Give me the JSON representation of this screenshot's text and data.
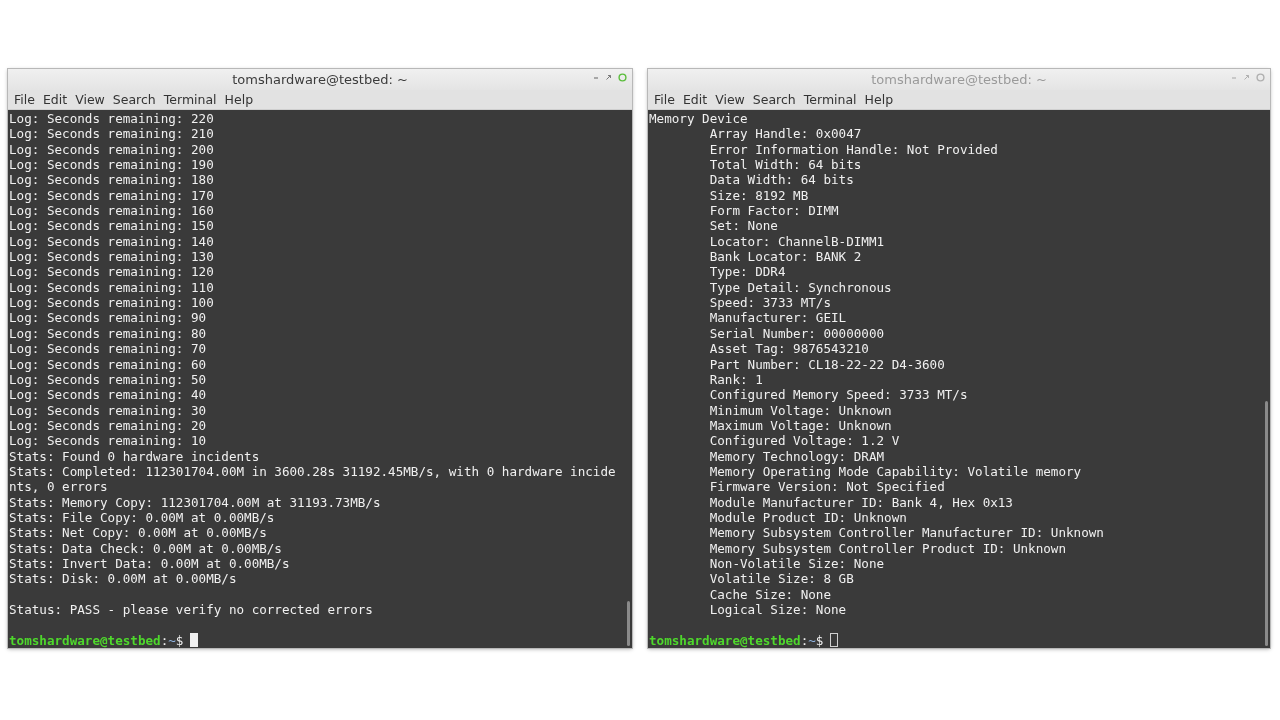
{
  "windows": [
    {
      "title": "tomshardware@testbed: ~",
      "focused": true,
      "menu": [
        "File",
        "Edit",
        "View",
        "Search",
        "Terminal",
        "Help"
      ],
      "lines": [
        {
          "kind": "text",
          "text": "Log: Seconds remaining: 220"
        },
        {
          "kind": "text",
          "text": "Log: Seconds remaining: 210"
        },
        {
          "kind": "text",
          "text": "Log: Seconds remaining: 200"
        },
        {
          "kind": "text",
          "text": "Log: Seconds remaining: 190"
        },
        {
          "kind": "text",
          "text": "Log: Seconds remaining: 180"
        },
        {
          "kind": "text",
          "text": "Log: Seconds remaining: 170"
        },
        {
          "kind": "text",
          "text": "Log: Seconds remaining: 160"
        },
        {
          "kind": "text",
          "text": "Log: Seconds remaining: 150"
        },
        {
          "kind": "text",
          "text": "Log: Seconds remaining: 140"
        },
        {
          "kind": "text",
          "text": "Log: Seconds remaining: 130"
        },
        {
          "kind": "text",
          "text": "Log: Seconds remaining: 120"
        },
        {
          "kind": "text",
          "text": "Log: Seconds remaining: 110"
        },
        {
          "kind": "text",
          "text": "Log: Seconds remaining: 100"
        },
        {
          "kind": "text",
          "text": "Log: Seconds remaining: 90"
        },
        {
          "kind": "text",
          "text": "Log: Seconds remaining: 80"
        },
        {
          "kind": "text",
          "text": "Log: Seconds remaining: 70"
        },
        {
          "kind": "text",
          "text": "Log: Seconds remaining: 60"
        },
        {
          "kind": "text",
          "text": "Log: Seconds remaining: 50"
        },
        {
          "kind": "text",
          "text": "Log: Seconds remaining: 40"
        },
        {
          "kind": "text",
          "text": "Log: Seconds remaining: 30"
        },
        {
          "kind": "text",
          "text": "Log: Seconds remaining: 20"
        },
        {
          "kind": "text",
          "text": "Log: Seconds remaining: 10"
        },
        {
          "kind": "text",
          "text": "Stats: Found 0 hardware incidents"
        },
        {
          "kind": "text",
          "text": "Stats: Completed: 112301704.00M in 3600.28s 31192.45MB/s, with 0 hardware incide"
        },
        {
          "kind": "text",
          "text": "nts, 0 errors"
        },
        {
          "kind": "text",
          "text": "Stats: Memory Copy: 112301704.00M at 31193.73MB/s"
        },
        {
          "kind": "text",
          "text": "Stats: File Copy: 0.00M at 0.00MB/s"
        },
        {
          "kind": "text",
          "text": "Stats: Net Copy: 0.00M at 0.00MB/s"
        },
        {
          "kind": "text",
          "text": "Stats: Data Check: 0.00M at 0.00MB/s"
        },
        {
          "kind": "text",
          "text": "Stats: Invert Data: 0.00M at 0.00MB/s"
        },
        {
          "kind": "text",
          "text": "Stats: Disk: 0.00M at 0.00MB/s"
        },
        {
          "kind": "blank"
        },
        {
          "kind": "text",
          "text": "Status: PASS - please verify no corrected errors"
        },
        {
          "kind": "blank"
        },
        {
          "kind": "prompt",
          "user": "tomshardware@testbed",
          "sep": ":",
          "path": "~",
          "symbol": "$"
        }
      ]
    },
    {
      "title": "tomshardware@testbed: ~",
      "focused": false,
      "menu": [
        "File",
        "Edit",
        "View",
        "Search",
        "Terminal",
        "Help"
      ],
      "lines": [
        {
          "kind": "text",
          "text": "Memory Device"
        },
        {
          "kind": "text",
          "text": "\tArray Handle: 0x0047"
        },
        {
          "kind": "text",
          "text": "\tError Information Handle: Not Provided"
        },
        {
          "kind": "text",
          "text": "\tTotal Width: 64 bits"
        },
        {
          "kind": "text",
          "text": "\tData Width: 64 bits"
        },
        {
          "kind": "text",
          "text": "\tSize: 8192 MB"
        },
        {
          "kind": "text",
          "text": "\tForm Factor: DIMM"
        },
        {
          "kind": "text",
          "text": "\tSet: None"
        },
        {
          "kind": "text",
          "text": "\tLocator: ChannelB-DIMM1"
        },
        {
          "kind": "text",
          "text": "\tBank Locator: BANK 2"
        },
        {
          "kind": "text",
          "text": "\tType: DDR4"
        },
        {
          "kind": "text",
          "text": "\tType Detail: Synchronous"
        },
        {
          "kind": "text",
          "text": "\tSpeed: 3733 MT/s"
        },
        {
          "kind": "text",
          "text": "\tManufacturer: GEIL"
        },
        {
          "kind": "text",
          "text": "\tSerial Number: 00000000"
        },
        {
          "kind": "text",
          "text": "\tAsset Tag: 9876543210"
        },
        {
          "kind": "text",
          "text": "\tPart Number: CL18-22-22 D4-3600"
        },
        {
          "kind": "text",
          "text": "\tRank: 1"
        },
        {
          "kind": "text",
          "text": "\tConfigured Memory Speed: 3733 MT/s"
        },
        {
          "kind": "text",
          "text": "\tMinimum Voltage: Unknown"
        },
        {
          "kind": "text",
          "text": "\tMaximum Voltage: Unknown"
        },
        {
          "kind": "text",
          "text": "\tConfigured Voltage: 1.2 V"
        },
        {
          "kind": "text",
          "text": "\tMemory Technology: DRAM"
        },
        {
          "kind": "text",
          "text": "\tMemory Operating Mode Capability: Volatile memory"
        },
        {
          "kind": "text",
          "text": "\tFirmware Version: Not Specified"
        },
        {
          "kind": "text",
          "text": "\tModule Manufacturer ID: Bank 4, Hex 0x13"
        },
        {
          "kind": "text",
          "text": "\tModule Product ID: Unknown"
        },
        {
          "kind": "text",
          "text": "\tMemory Subsystem Controller Manufacturer ID: Unknown"
        },
        {
          "kind": "text",
          "text": "\tMemory Subsystem Controller Product ID: Unknown"
        },
        {
          "kind": "text",
          "text": "\tNon-Volatile Size: None"
        },
        {
          "kind": "text",
          "text": "\tVolatile Size: 8 GB"
        },
        {
          "kind": "text",
          "text": "\tCache Size: None"
        },
        {
          "kind": "text",
          "text": "\tLogical Size: None"
        },
        {
          "kind": "blank"
        },
        {
          "kind": "prompt",
          "user": "tomshardware@testbed",
          "sep": ":",
          "path": "~",
          "symbol": "$"
        }
      ]
    }
  ]
}
